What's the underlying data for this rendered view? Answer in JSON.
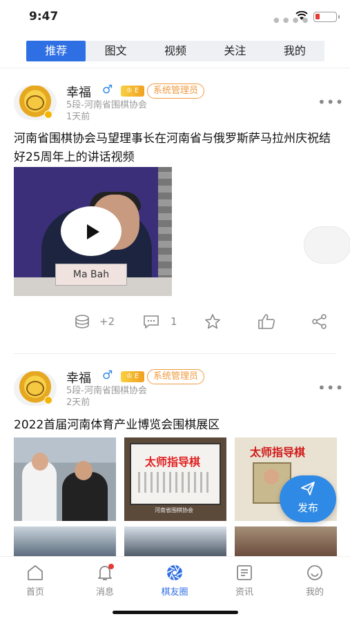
{
  "status_bar": {
    "time": "9:47"
  },
  "tabs": [
    {
      "label": "推荐",
      "active": true
    },
    {
      "label": "图文",
      "active": false
    },
    {
      "label": "视频",
      "active": false
    },
    {
      "label": "关注",
      "active": false
    },
    {
      "label": "我的",
      "active": false
    }
  ],
  "posts": [
    {
      "user": "幸福",
      "gender_icon": "male-icon",
      "level_badge": "lv-badge",
      "role": "系统管理员",
      "meta": "5段-河南省围棋协会",
      "time": "1天前",
      "title": "河南省围棋协会马望理事长在河南省与俄罗斯萨马拉州庆祝结好25周年上的讲话视频",
      "video_nameplate": "Ma Bah",
      "actions": {
        "coins": "+2",
        "comments": "1"
      }
    },
    {
      "user": "幸福",
      "gender_icon": "male-icon",
      "level_badge": "lv-badge",
      "role": "系统管理员",
      "meta": "5段-河南省围棋协会",
      "time": "2天前",
      "title": "2022首届河南体育产业博览会围棋展区",
      "images": {
        "banner_1": "太师指导棋",
        "banner_2": "太师指导棋",
        "booth_sign": "河南省围棋协会"
      }
    }
  ],
  "fab": {
    "label": "发布"
  },
  "bottom_nav": [
    {
      "label": "首页",
      "icon": "home-icon",
      "active": false
    },
    {
      "label": "消息",
      "icon": "bell-icon",
      "active": false,
      "badge": true
    },
    {
      "label": "棋友圈",
      "icon": "aperture-icon",
      "active": true
    },
    {
      "label": "资讯",
      "icon": "news-icon",
      "active": false
    },
    {
      "label": "我的",
      "icon": "profile-icon",
      "active": false
    }
  ],
  "colors": {
    "accent": "#2f6fe4",
    "role_orange": "#f19a3e",
    "badge_red": "#e53935"
  }
}
